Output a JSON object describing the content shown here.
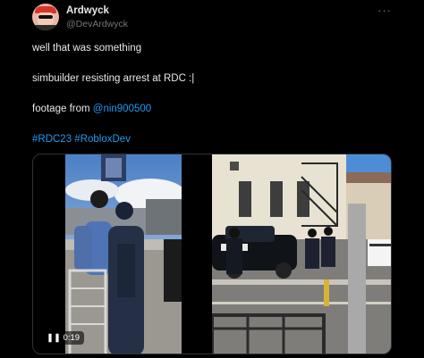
{
  "tweet": {
    "display_name": "Ardwyck",
    "handle": "@DevArdwyck",
    "more_icon": "more-dots-icon",
    "lines": [
      "well that was something",
      "simbuilder resisting arrest at RDC :|"
    ],
    "footage_prefix": "footage from ",
    "footage_mention": "@nin900500",
    "hashtags": "#RDC23 #RobloxDev"
  },
  "media": {
    "timestamp": "0:19",
    "play_icon": "pause-icon"
  },
  "colors": {
    "background": "#000000",
    "text": "#e7e9ea",
    "muted": "#71767b",
    "link": "#1d9bf0"
  }
}
